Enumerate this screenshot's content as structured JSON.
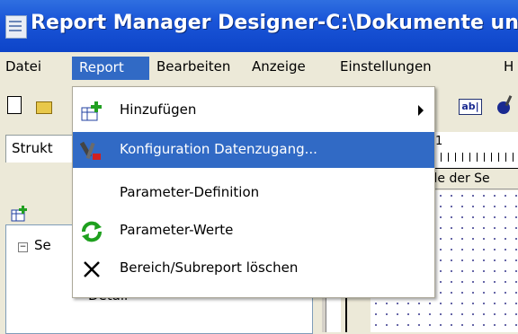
{
  "window": {
    "title": "Report Manager Designer-C:\\Dokumente un"
  },
  "menubar": {
    "items": [
      {
        "label": "Datei"
      },
      {
        "label": "Report"
      },
      {
        "label": "Bearbeiten"
      },
      {
        "label": "Anzeige"
      },
      {
        "label": "Einstellungen"
      },
      {
        "label": "H"
      }
    ]
  },
  "toolbar": {
    "text_button": "ab|"
  },
  "left_panel": {
    "tab_label": "Strukt",
    "tree_root": "Se",
    "tree_child": "Detail"
  },
  "designer": {
    "ruler_number": "1",
    "section_label": "eile der Se"
  },
  "report_menu": {
    "items": [
      {
        "label": "Hinzufügen",
        "icon": "add-section-icon",
        "submenu": true
      },
      {
        "label": "Konfiguration Datenzugang...",
        "icon": "tools-icon",
        "highlighted": true
      },
      {
        "label": "Parameter-Definition",
        "icon": ""
      },
      {
        "label": "Parameter-Werte",
        "icon": "refresh-icon"
      },
      {
        "label": "Bereich/Subreport löschen",
        "icon": "delete-x-icon"
      }
    ]
  },
  "colors": {
    "title_bar": "#0d44c8",
    "menu_highlight": "#316ac5",
    "face": "#ece9d8"
  }
}
